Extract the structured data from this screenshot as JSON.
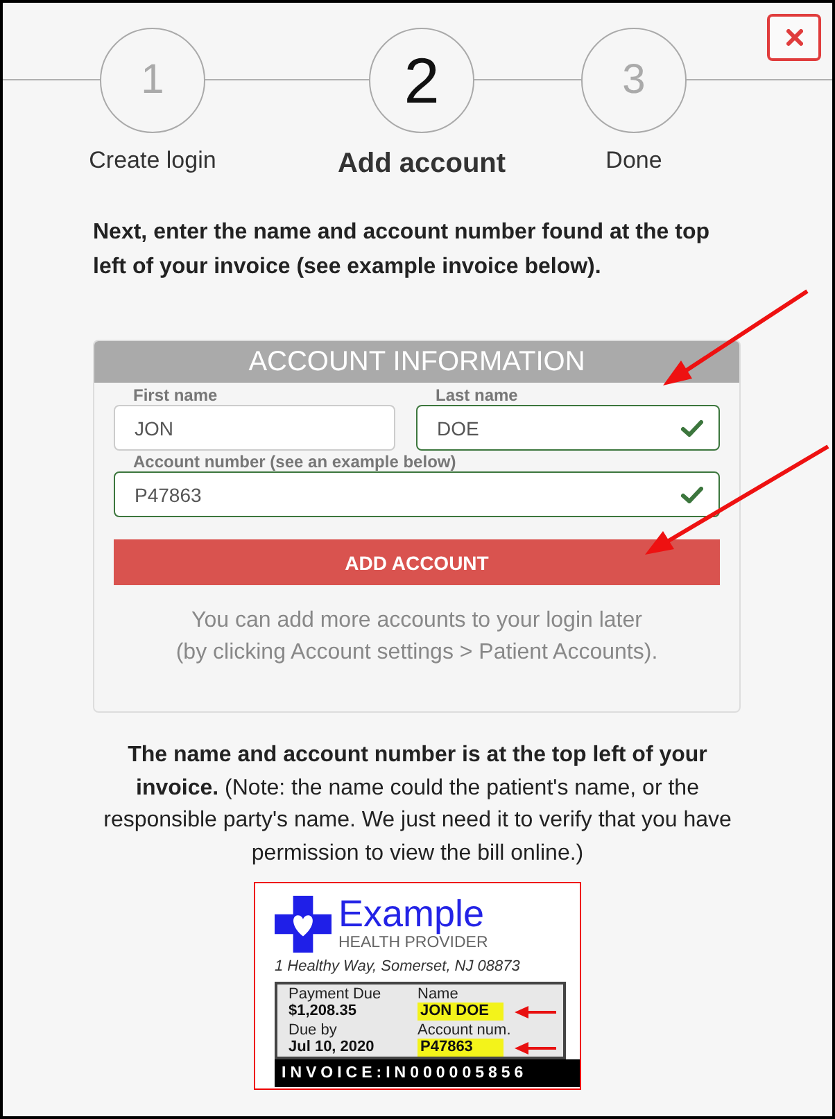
{
  "steps": [
    {
      "number": "1",
      "label": "Create login",
      "selected": false
    },
    {
      "number": "2",
      "label": "Add account",
      "selected": true
    },
    {
      "number": "3",
      "label": "Done",
      "selected": false
    }
  ],
  "instruction": "Next, enter the name and account number found at the top left of your invoice (see example invoice below).",
  "account_form": {
    "title": "ACCOUNT INFORMATION",
    "fields": [
      {
        "label": "First name",
        "value": "JON",
        "valid": false
      },
      {
        "label": "Last name",
        "value": "DOE",
        "valid": true
      },
      {
        "label": "Account number (see an example below)",
        "value": "P47863",
        "valid": true
      }
    ],
    "submit": "ADD ACCOUNT",
    "note": "You can add more accounts to your login later\n(by clicking Account settings > Patient Accounts)."
  },
  "explanation": "**The name and account number is at the top left of your invoice.** (Note: the name could the patient's name, or the responsible party's name. We just need it to verify that you have permission to view the bill online.)",
  "invoice": {
    "brand": "Example",
    "brand_subtitle": "HEALTH PROVIDER",
    "address": "1 Healthy Way, Somerset, NJ 08873",
    "fields": [
      {
        "label": "Payment Due",
        "value": "$1,208.35",
        "highlighted": false
      },
      {
        "label": "Name",
        "value": "JON DOE",
        "highlighted": true
      },
      {
        "label": "Due by",
        "value": "Jul 10, 2020",
        "highlighted": false
      },
      {
        "label": "Account num.",
        "value": "P47863",
        "highlighted": true
      }
    ],
    "invoice_number": "INVOICE:IN000005856"
  }
}
